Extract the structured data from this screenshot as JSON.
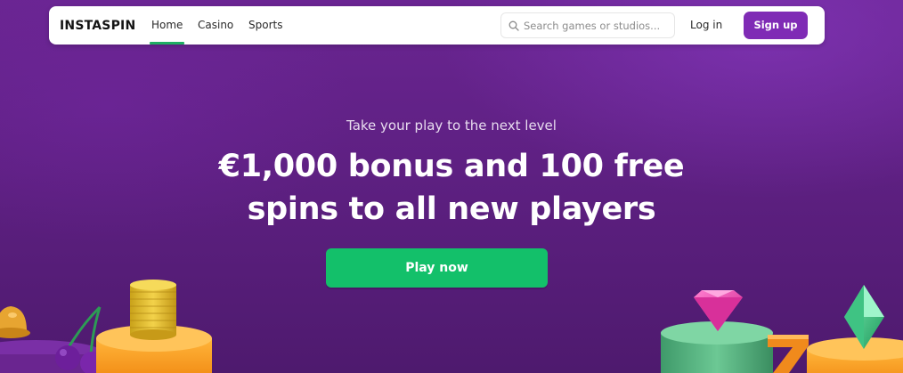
{
  "brand": {
    "logo_text": "INSTASPIN"
  },
  "nav": {
    "links": [
      {
        "label": "Home",
        "active": true
      },
      {
        "label": "Casino",
        "active": false
      },
      {
        "label": "Sports",
        "active": false
      }
    ],
    "search": {
      "placeholder": "Search games or studios...",
      "icon": "search-icon"
    },
    "login_label": "Log in",
    "signup_label": "Sign up"
  },
  "hero": {
    "subtitle": "Take your play to the next level",
    "headline_line1": "€1,000 bonus and 100 free",
    "headline_line2": "spins to all new players",
    "cta_label": "Play now"
  },
  "colors": {
    "background": "#5e2082",
    "accent_green": "#13c06a",
    "brand_purple": "#7f2bb5",
    "nav_active_underline": "#1fae63"
  },
  "decor_icons": [
    "bell-icon",
    "cherries-icon",
    "coin-stack-icon",
    "diamond-icon",
    "lucky-seven-icon",
    "emerald-gem-icon"
  ]
}
